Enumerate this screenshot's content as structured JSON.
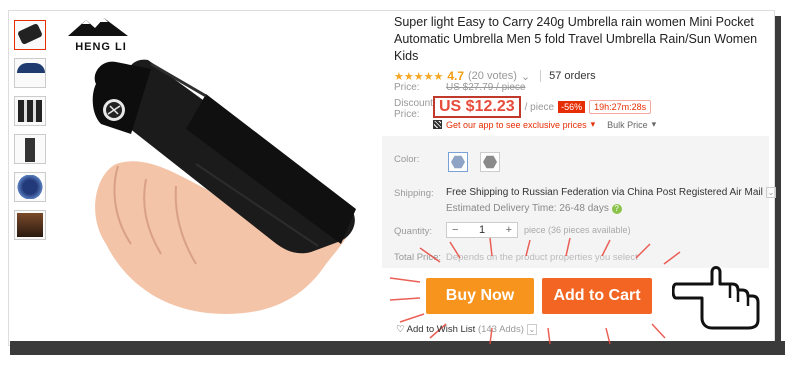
{
  "brand": {
    "logo_text": "HENG LI"
  },
  "thumbnails": [
    {
      "name": "thumb-umbrella-hand",
      "selected": true
    },
    {
      "name": "thumb-umbrella-open"
    },
    {
      "name": "thumb-umbrella-parts"
    },
    {
      "name": "thumb-umbrella-size"
    },
    {
      "name": "thumb-umbrella-blue"
    },
    {
      "name": "thumb-umbrella-person"
    }
  ],
  "product": {
    "title": "Super light Easy to Carry 240g Umbrella rain women Mini Pocket Automatic Umbrella Men 5 fold Travel Umbrella Rain/Sun Women Kids",
    "stars": "★★★★★",
    "score": "4.7",
    "votes": "(20 votes)",
    "orders": "57 orders"
  },
  "price": {
    "label": "Price:",
    "old": "US $27.79 / piece",
    "discount_label_1": "Discount",
    "discount_label_2": "Price:",
    "new": "US $12.23",
    "per": "/ piece",
    "discount": "-56%",
    "timer": "19h:27m:28s",
    "app_link": "Get our app to see exclusive prices",
    "bulk": "Bulk Price"
  },
  "options": {
    "color_label": "Color:",
    "shipping_label": "Shipping:",
    "shipping_text": "Free Shipping to Russian Federation via China Post Registered Air Mail",
    "delivery_label": "Estimated Delivery Time:",
    "delivery_value": "26-48 days",
    "quantity_label": "Quantity:",
    "quantity_minus": "−",
    "quantity_value": "1",
    "quantity_plus": "+",
    "pieces_available": "piece (36 pieces available)",
    "total_label": "Total Price:",
    "total_text": "Depends on the product properties you select"
  },
  "actions": {
    "buy_now": "Buy Now",
    "add_to_cart": "Add to Cart",
    "wish_text": "Add to Wish List",
    "wish_count": "(143 Adds)"
  },
  "colors": {
    "accent": "#e62e04",
    "buy": "#f7941e",
    "cart": "#f26522",
    "swatch1": "#8fa4c4",
    "swatch2": "#8a8a8a"
  }
}
